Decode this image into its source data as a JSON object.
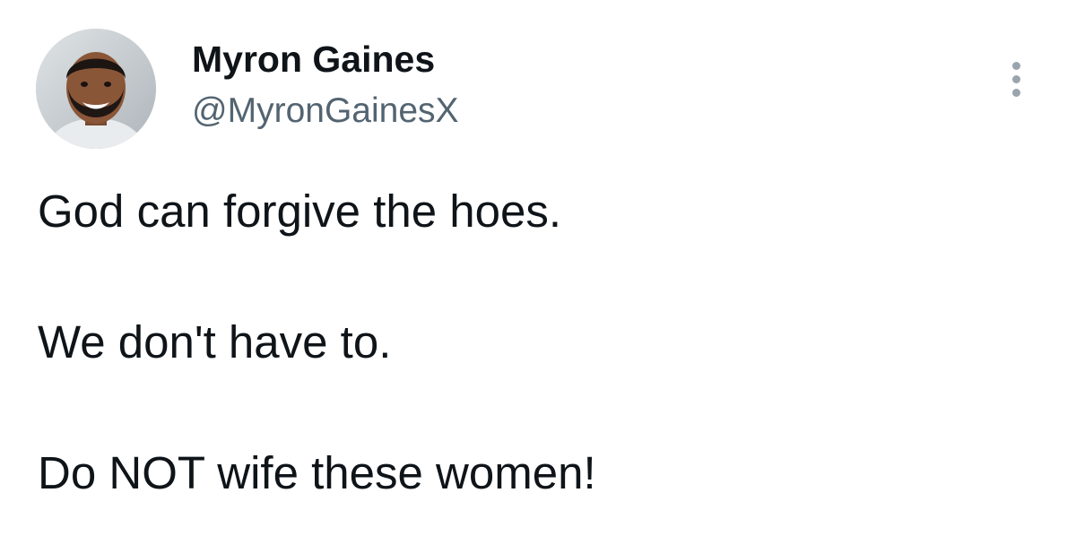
{
  "tweet": {
    "display_name": "Myron Gaines",
    "handle": "@MyronGainesX",
    "lines": [
      "God can forgive the hoes.",
      "We don't have to.",
      "Do NOT wife these women!"
    ]
  },
  "icons": {
    "avatar": "profile-photo",
    "more": "more-options-icon"
  },
  "colors": {
    "text": "#0f1419",
    "secondary_text": "#536471",
    "more_dots": "#9aa4ad",
    "background": "#ffffff"
  }
}
